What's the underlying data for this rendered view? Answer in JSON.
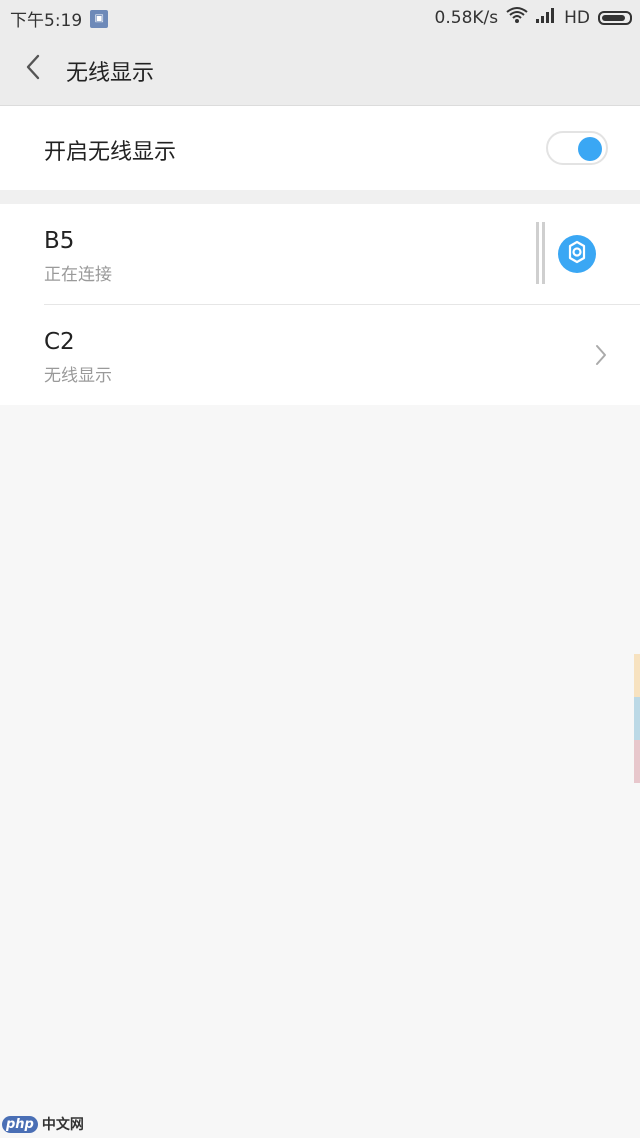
{
  "status_bar": {
    "time": "下午5:19",
    "notification_icon": "image-notification-icon",
    "network_speed": "0.58K/s",
    "network_type": "HD",
    "battery_level": 0.9
  },
  "header": {
    "title": "无线显示",
    "back_icon": "chevron-left-icon"
  },
  "wireless_toggle": {
    "label": "开启无线显示",
    "enabled": true,
    "accent_color": "#3aa7f4"
  },
  "devices": [
    {
      "name": "B5",
      "status": "正在连接",
      "action_icon": "gear-icon"
    },
    {
      "name": "C2",
      "status": "无线显示",
      "action_icon": "chevron-right-icon"
    }
  ],
  "edge_strip_colors": [
    "#f7e2c0",
    "#bcd9e6",
    "#e8c7cc"
  ],
  "watermark": {
    "badge": "php",
    "text": "中文网"
  }
}
